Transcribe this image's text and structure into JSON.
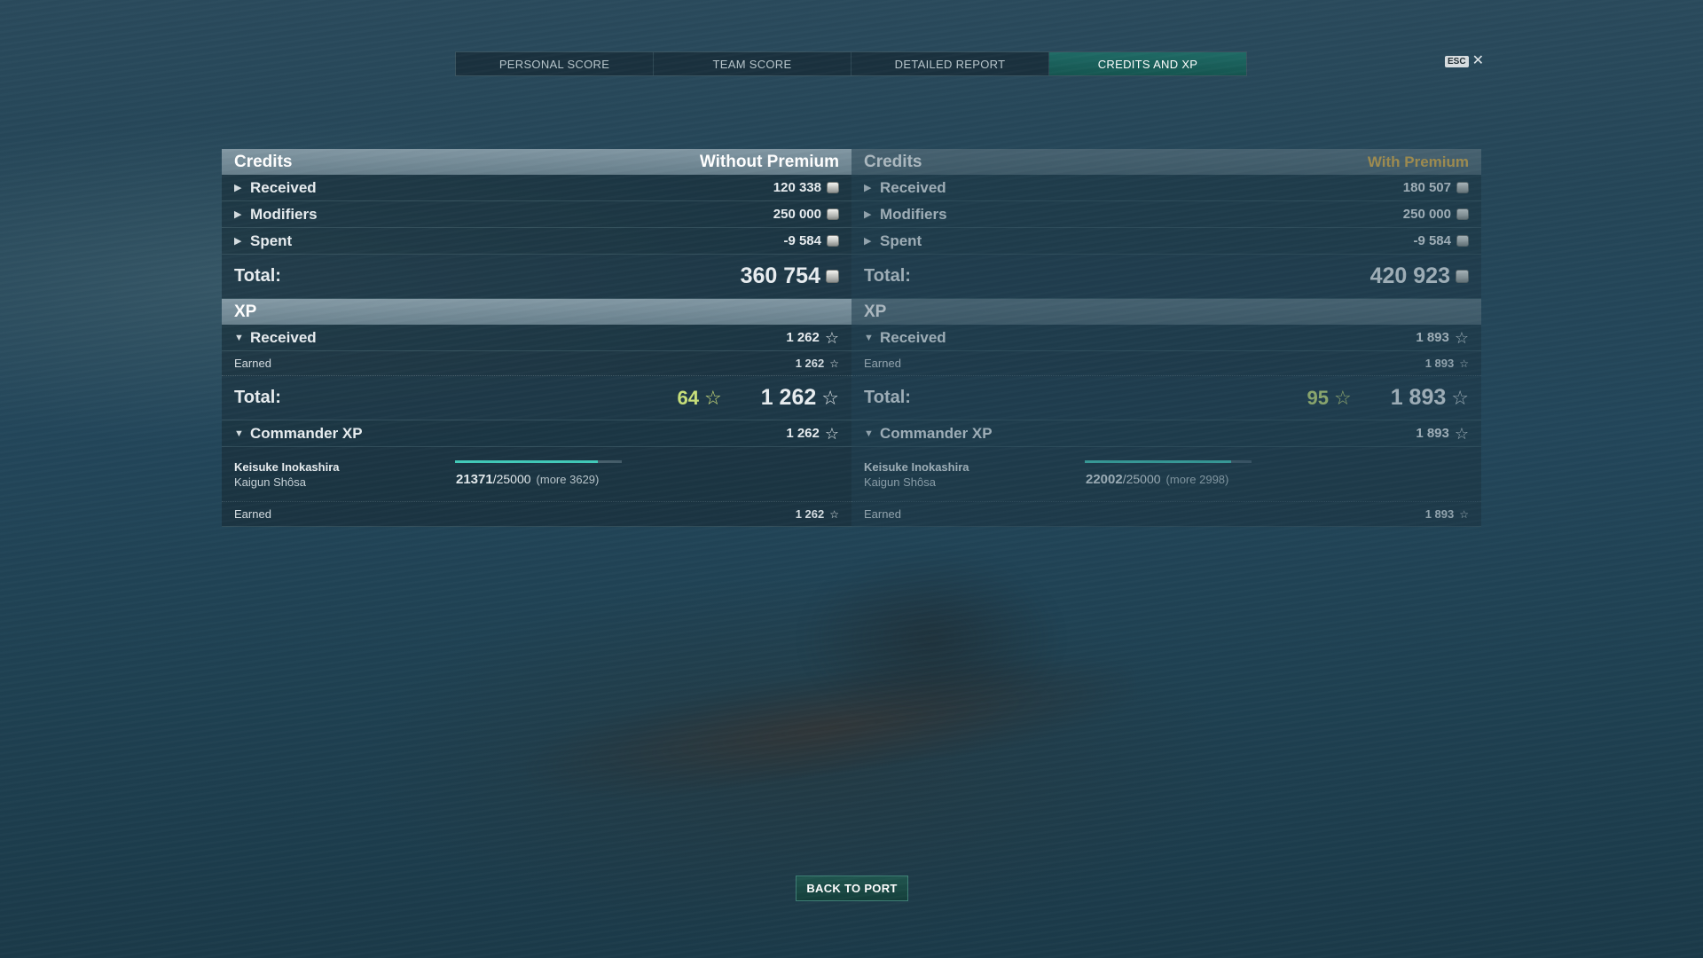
{
  "tabs": [
    {
      "label": "PERSONAL SCORE"
    },
    {
      "label": "TEAM SCORE"
    },
    {
      "label": "DETAILED REPORT"
    },
    {
      "label": "CREDITS AND XP",
      "active": true
    }
  ],
  "close": {
    "key_label": "ESC",
    "icon": "close-icon"
  },
  "panels": {
    "without_premium": {
      "credits_title": "Credits",
      "premium_label": "Without Premium",
      "credits_rows": [
        {
          "label": "Received",
          "value": "120 338"
        },
        {
          "label": "Modifiers",
          "value": "250 000"
        },
        {
          "label": "Spent",
          "value": "-9 584"
        }
      ],
      "total_label": "Total:",
      "credits_total": "360 754",
      "xp_title": "XP",
      "xp_received_label": "Received",
      "xp_received": "1 262",
      "xp_earned_label": "Earned",
      "xp_earned": "1 262",
      "xp_total_label": "Total:",
      "xp_bonus": "64",
      "xp_total": "1 262",
      "commander_label": "Commander XP",
      "commander_xp": "1 262",
      "commander_name": "Keisuke Inokashira",
      "commander_rank": "Kaigun Shôsa",
      "commander_progress_current": "21371",
      "commander_progress_max": "/25000",
      "commander_progress_more": "(more 3629)",
      "commander_progress_fraction": 0.855,
      "commander_earned_label": "Earned",
      "commander_earned": "1 262"
    },
    "with_premium": {
      "credits_title": "Credits",
      "premium_label": "With Premium",
      "credits_rows": [
        {
          "label": "Received",
          "value": "180 507"
        },
        {
          "label": "Modifiers",
          "value": "250 000"
        },
        {
          "label": "Spent",
          "value": "-9 584"
        }
      ],
      "total_label": "Total:",
      "credits_total": "420 923",
      "xp_title": "XP",
      "xp_received_label": "Received",
      "xp_received": "1 893",
      "xp_earned_label": "Earned",
      "xp_earned": "1 893",
      "xp_total_label": "Total:",
      "xp_bonus": "95",
      "xp_total": "1 893",
      "commander_label": "Commander XP",
      "commander_xp": "1 893",
      "commander_name": "Keisuke Inokashira",
      "commander_rank": "Kaigun Shôsa",
      "commander_progress_current": "22002",
      "commander_progress_max": "/25000",
      "commander_progress_more": "(more 2998)",
      "commander_progress_fraction": 0.88,
      "commander_earned_label": "Earned",
      "commander_earned": "1 893"
    }
  },
  "footer": {
    "back_label": "BACK TO PORT"
  },
  "colors": {
    "accent": "#1f6b66",
    "premium": "#e7b54a",
    "bonus_xp": "#c8e07a",
    "progress": "#41c9b8"
  }
}
